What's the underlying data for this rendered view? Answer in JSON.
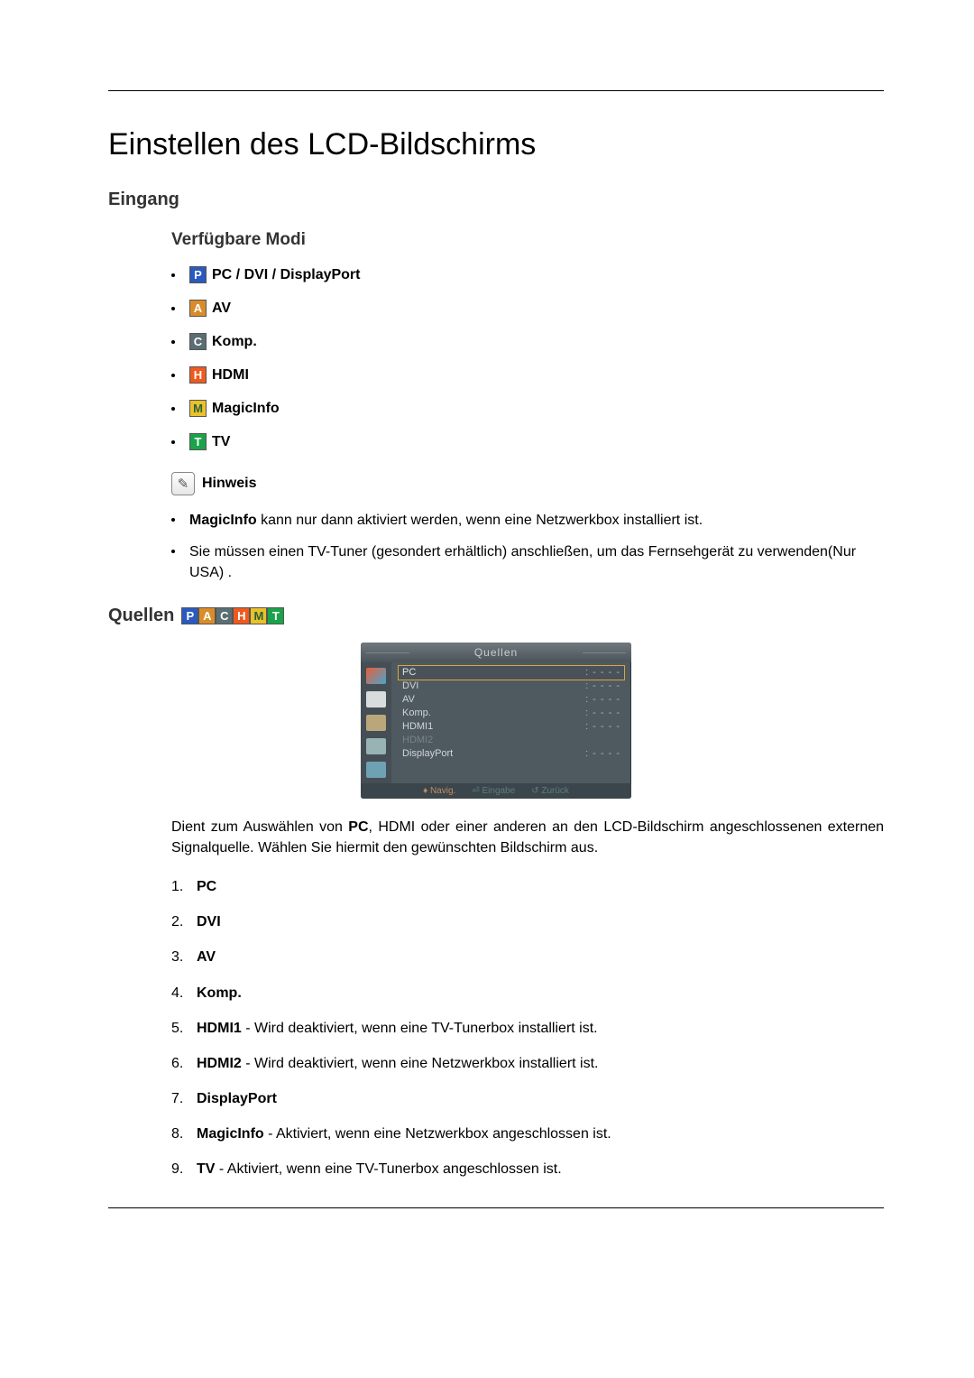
{
  "doc_title": "Einstellen des LCD-Bildschirms",
  "sections": {
    "eingang": "Eingang",
    "verfuegbare_modi": "Verfügbare Modi",
    "quellen": "Quellen"
  },
  "modes": [
    {
      "icon": "P",
      "cls": "ico-p",
      "label": "PC / DVI / DisplayPort"
    },
    {
      "icon": "A",
      "cls": "ico-a",
      "label": "AV"
    },
    {
      "icon": "C",
      "cls": "ico-c",
      "label": "Komp."
    },
    {
      "icon": "H",
      "cls": "ico-h",
      "label": "HDMI"
    },
    {
      "icon": "M",
      "cls": "ico-m",
      "label": "MagicInfo"
    },
    {
      "icon": "T",
      "cls": "ico-t",
      "label": "TV"
    }
  ],
  "hinweis_label": "Hinweis",
  "hinweis_items": [
    {
      "bold": "MagicInfo",
      "text": " kann nur dann aktiviert werden, wenn eine Netzwerkbox installiert ist."
    },
    {
      "bold": "",
      "text": "Sie müssen einen TV-Tuner (gesondert erhältlich) anschließen, um das Fernsehgerät zu verwenden(Nur USA) ."
    }
  ],
  "osd": {
    "title": "Quellen",
    "rows": [
      {
        "name": "PC",
        "val": "- - - -",
        "sel": true
      },
      {
        "name": "DVI",
        "val": "- - - -"
      },
      {
        "name": "AV",
        "val": "- - - -"
      },
      {
        "name": "Komp.",
        "val": "- - - -"
      },
      {
        "name": "HDMI1",
        "val": "- - - -"
      },
      {
        "name": "HDMI2",
        "val": "",
        "disabled": true
      },
      {
        "name": "DisplayPort",
        "val": "- - - -"
      }
    ],
    "footer": {
      "nav": "Navig.",
      "enter": "Eingabe",
      "back": "Zurück"
    }
  },
  "quellen_para_pre": "Dient zum Auswählen von ",
  "quellen_para_bold": "PC",
  "quellen_para_post": ", HDMI oder einer anderen an den LCD-Bildschirm angeschlossenen externen Signalquelle. Wählen Sie hiermit den gewünschten Bildschirm aus.",
  "quellen_list": [
    {
      "num": "1.",
      "bold": "PC",
      "rest": ""
    },
    {
      "num": "2.",
      "bold": "DVI",
      "rest": ""
    },
    {
      "num": "3.",
      "bold": "AV",
      "rest": ""
    },
    {
      "num": "4.",
      "bold": "Komp.",
      "rest": ""
    },
    {
      "num": "5.",
      "bold": "HDMI1",
      "rest": " - Wird deaktiviert, wenn eine TV-Tunerbox installiert ist."
    },
    {
      "num": "6.",
      "bold": "HDMI2",
      "rest": " - Wird deaktiviert, wenn eine Netzwerkbox installiert ist."
    },
    {
      "num": "7.",
      "bold": "DisplayPort",
      "rest": ""
    },
    {
      "num": "8.",
      "bold": "MagicInfo",
      "rest": " - Aktiviert, wenn eine Netzwerkbox angeschlossen ist."
    },
    {
      "num": "9.",
      "bold": "TV",
      "rest": " - Aktiviert, wenn eine TV-Tunerbox angeschlossen ist."
    }
  ]
}
